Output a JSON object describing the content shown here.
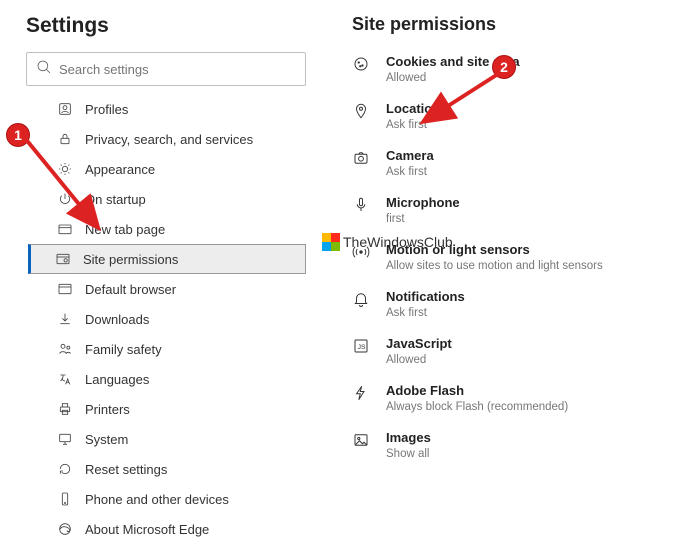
{
  "sidebar": {
    "title": "Settings",
    "search_placeholder": "Search settings",
    "items": [
      {
        "label": "Profiles"
      },
      {
        "label": "Privacy, search, and services"
      },
      {
        "label": "Appearance"
      },
      {
        "label": "On startup"
      },
      {
        "label": "New tab page"
      },
      {
        "label": "Site permissions"
      },
      {
        "label": "Default browser"
      },
      {
        "label": "Downloads"
      },
      {
        "label": "Family safety"
      },
      {
        "label": "Languages"
      },
      {
        "label": "Printers"
      },
      {
        "label": "System"
      },
      {
        "label": "Reset settings"
      },
      {
        "label": "Phone and other devices"
      },
      {
        "label": "About Microsoft Edge"
      }
    ]
  },
  "main": {
    "title": "Site permissions",
    "items": [
      {
        "name": "Cookies and site data",
        "sub": "Allowed"
      },
      {
        "name": "Location",
        "sub": "Ask first"
      },
      {
        "name": "Camera",
        "sub": "Ask first"
      },
      {
        "name": "Microphone",
        "sub": "first"
      },
      {
        "name": "Motion or light sensors",
        "sub": "Allow sites to use motion and light sensors"
      },
      {
        "name": "Notifications",
        "sub": "Ask first"
      },
      {
        "name": "JavaScript",
        "sub": "Allowed"
      },
      {
        "name": "Adobe Flash",
        "sub": "Always block Flash (recommended)"
      },
      {
        "name": "Images",
        "sub": "Show all"
      }
    ]
  },
  "annotations": {
    "badge1": "1",
    "badge2": "2",
    "watermark": "TheWindowsClub"
  }
}
